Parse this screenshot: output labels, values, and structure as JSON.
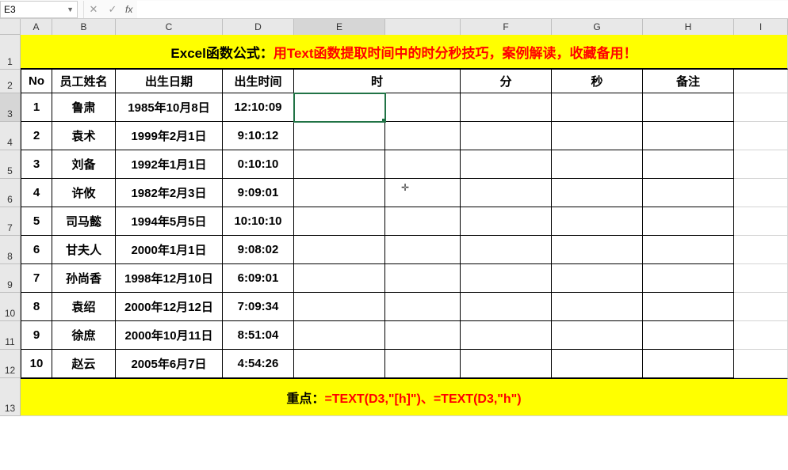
{
  "nameBox": "E3",
  "formula": "",
  "colHeaders": [
    "A",
    "B",
    "C",
    "D",
    "E",
    "",
    "F",
    "G",
    "H",
    "I"
  ],
  "rowHeaders": [
    "1",
    "2",
    "3",
    "4",
    "5",
    "6",
    "7",
    "8",
    "9",
    "10",
    "11",
    "12",
    "13"
  ],
  "titlePart1": "Excel函数公式：",
  "titlePart2": "用Text函数提取时间中的时分秒技巧，案例解读，收藏备用！",
  "headers": {
    "no": "No",
    "name": "员工姓名",
    "bdate": "出生日期",
    "btime": "出生时间",
    "hour": "时",
    "minute": "分",
    "second": "秒",
    "remark": "备注"
  },
  "rows": [
    {
      "no": "1",
      "name": "鲁肃",
      "bdate": "1985年10月8日",
      "btime": "12:10:09"
    },
    {
      "no": "2",
      "name": "袁术",
      "bdate": "1999年2月1日",
      "btime": "9:10:12"
    },
    {
      "no": "3",
      "name": "刘备",
      "bdate": "1992年1月1日",
      "btime": "0:10:10"
    },
    {
      "no": "4",
      "name": "许攸",
      "bdate": "1982年2月3日",
      "btime": "9:09:01"
    },
    {
      "no": "5",
      "name": "司马懿",
      "bdate": "1994年5月5日",
      "btime": "10:10:10"
    },
    {
      "no": "6",
      "name": "甘夫人",
      "bdate": "2000年1月1日",
      "btime": "9:08:02"
    },
    {
      "no": "7",
      "name": "孙尚香",
      "bdate": "1998年12月10日",
      "btime": "6:09:01"
    },
    {
      "no": "8",
      "name": "袁绍",
      "bdate": "2000年12月12日",
      "btime": "7:09:34"
    },
    {
      "no": "9",
      "name": "徐庶",
      "bdate": "2000年10月11日",
      "btime": "8:51:04"
    },
    {
      "no": "10",
      "name": "赵云",
      "bdate": "2005年6月7日",
      "btime": "4:54:26"
    }
  ],
  "footerLabel": "重点：",
  "footerFormula": "=TEXT(D3,\"[h]\")、=TEXT(D3,\"h\")"
}
